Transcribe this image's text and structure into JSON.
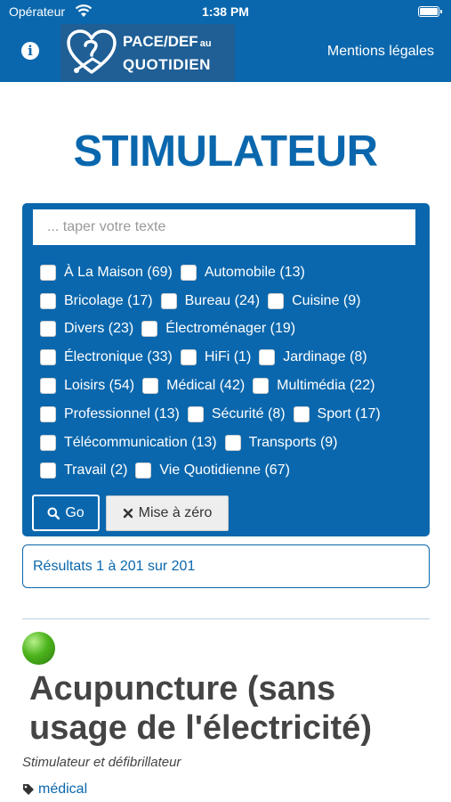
{
  "status_bar": {
    "carrier": "Opérateur",
    "time": "1:38 PM"
  },
  "header": {
    "info_icon": "info-circle-icon",
    "logo": {
      "line1": "PACE/DEF",
      "line1_small": "au",
      "line2": "QUOTIDIEN"
    },
    "mentions_label": "Mentions légales"
  },
  "page_title": "STIMULATEUR",
  "search": {
    "placeholder": "... taper votre texte",
    "value": "",
    "filter_rows": [
      [
        {
          "label": "À La Maison (69)",
          "checked": false
        },
        {
          "label": "Automobile (13)",
          "checked": false
        }
      ],
      [
        {
          "label": "Bricolage (17)",
          "checked": false
        },
        {
          "label": "Bureau (24)",
          "checked": false
        },
        {
          "label": "Cuisine (9)",
          "checked": false
        }
      ],
      [
        {
          "label": "Divers (23)",
          "checked": false
        },
        {
          "label": "Électroménager (19)",
          "checked": false
        }
      ],
      [
        {
          "label": "Électronique (33)",
          "checked": false
        },
        {
          "label": "HiFi (1)",
          "checked": false
        },
        {
          "label": "Jardinage (8)",
          "checked": false
        }
      ],
      [
        {
          "label": "Loisirs (54)",
          "checked": false
        },
        {
          "label": "Médical (42)",
          "checked": false
        },
        {
          "label": "Multimédia (22)",
          "checked": false
        }
      ],
      [
        {
          "label": "Professionnel (13)",
          "checked": false
        },
        {
          "label": "Sécurité (8)",
          "checked": false
        },
        {
          "label": "Sport (17)",
          "checked": false
        }
      ],
      [
        {
          "label": "Télécommunication (13)",
          "checked": false
        },
        {
          "label": "Transports (9)",
          "checked": false
        }
      ],
      [
        {
          "label": "Travail (2)",
          "checked": false
        },
        {
          "label": "Vie Quotidienne (67)",
          "checked": false
        }
      ]
    ],
    "go_label": "Go",
    "reset_label": "Mise à zéro"
  },
  "results_text": "Résultats 1 à 201 sur 201",
  "item": {
    "status_color": "#4cb41d",
    "title": "Acupuncture (sans usage de l'électricité)",
    "subtitle": "Stimulateur et défibrillateur",
    "tag": "médical"
  },
  "colors": {
    "brand_blue": "#0a67ad",
    "logo_blue": "#1f5f96"
  }
}
